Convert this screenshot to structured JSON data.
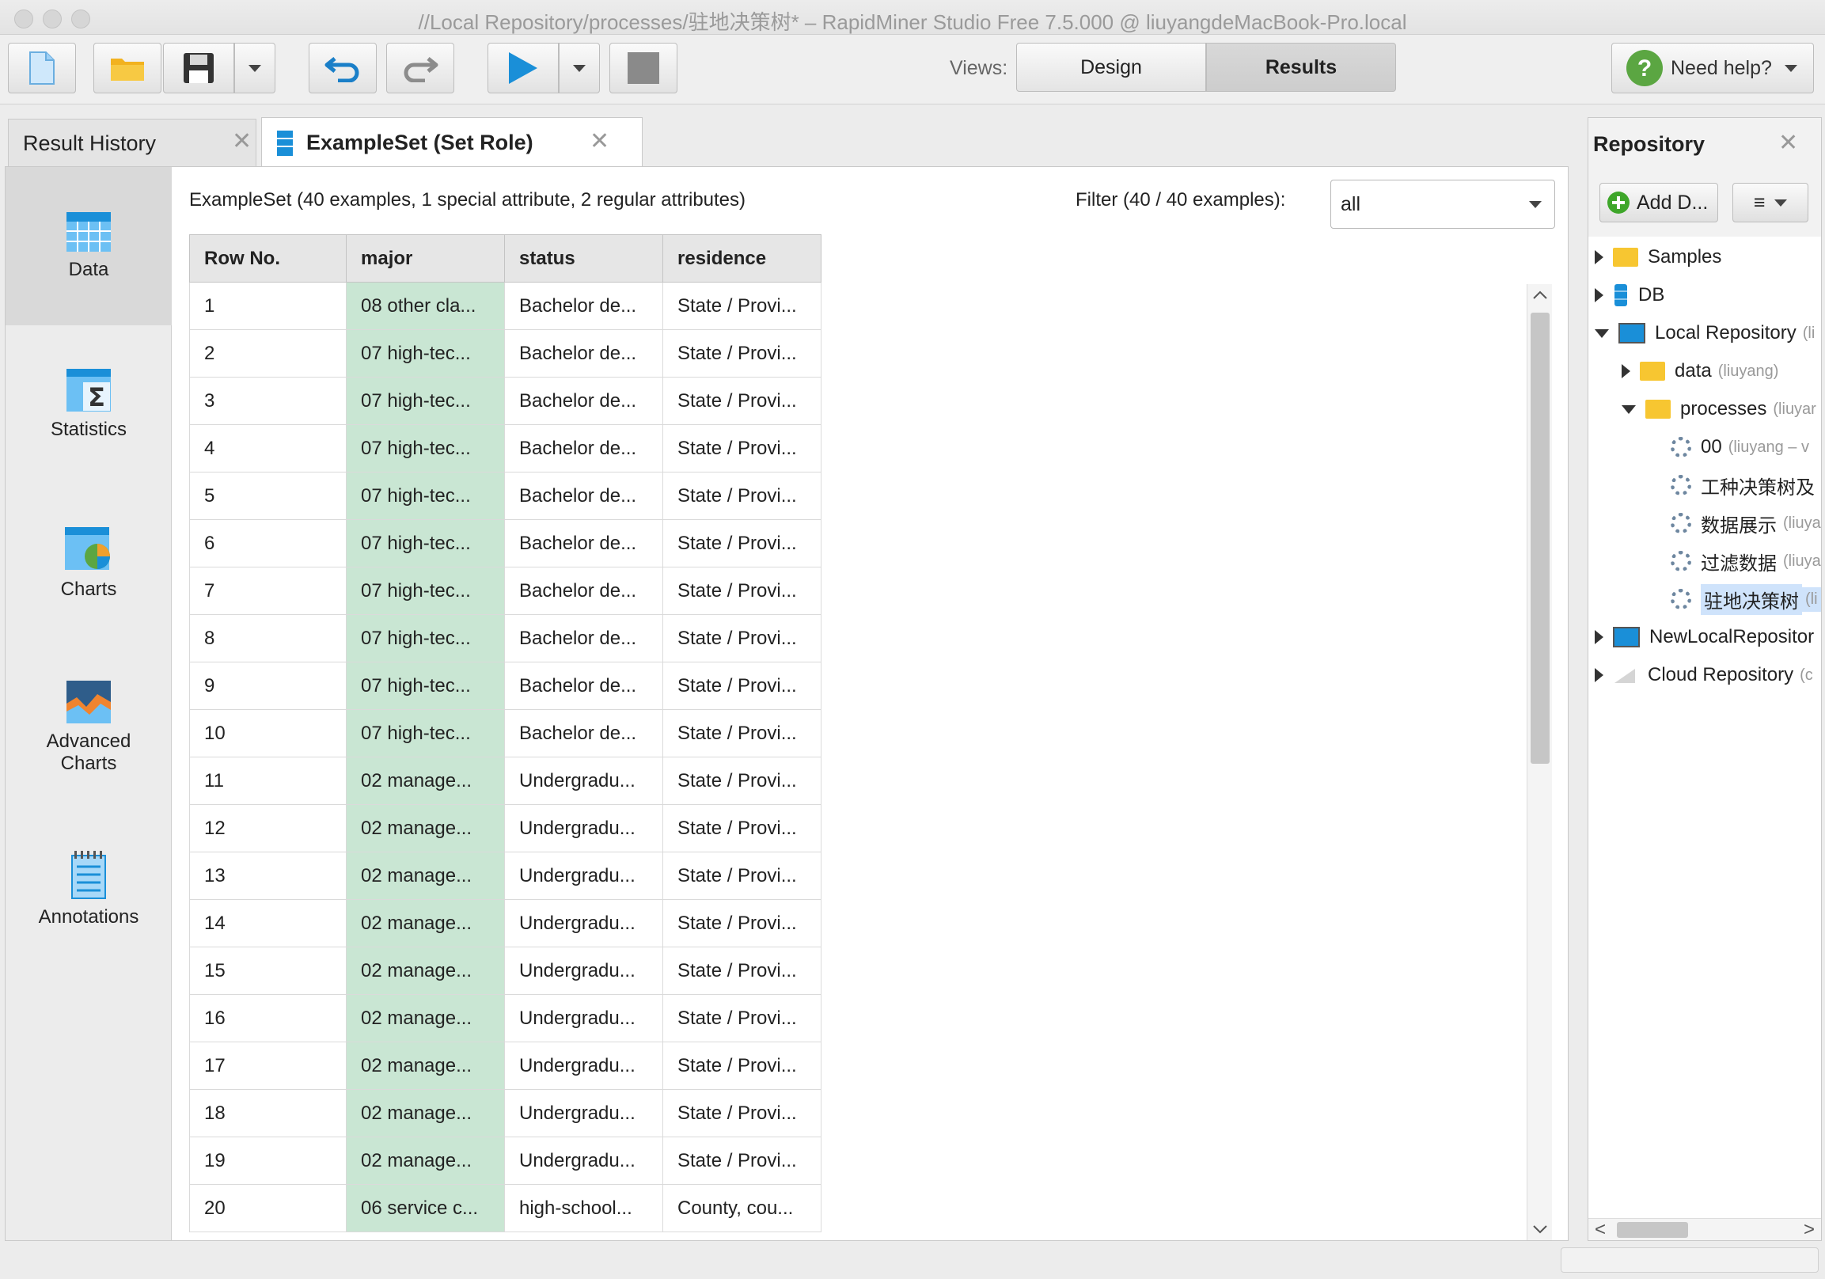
{
  "window": {
    "title": "//Local Repository/processes/驻地决策树* – RapidMiner Studio Free 7.5.000 @ liuyangdeMacBook-Pro.local"
  },
  "toolbar": {
    "views_label": "Views:",
    "design_label": "Design",
    "results_label": "Results",
    "help_label": "Need help?"
  },
  "tabs": {
    "result_history": "Result History",
    "exampleset": "ExampleSet (Set Role)"
  },
  "sidenav": [
    {
      "label": "Data"
    },
    {
      "label": "Statistics"
    },
    {
      "label": "Charts"
    },
    {
      "label": "Advanced Charts"
    },
    {
      "label": "Annotations"
    }
  ],
  "results": {
    "summary": "ExampleSet (40 examples, 1 special attribute, 2 regular attributes)",
    "filter_label": "Filter (40 / 40 examples):",
    "filter_value": "all",
    "columns": [
      "Row No.",
      "major",
      "status",
      "residence"
    ],
    "rows": [
      [
        "1",
        "08 other cla...",
        "Bachelor de...",
        "State / Provi..."
      ],
      [
        "2",
        "07 high-tec...",
        "Bachelor de...",
        "State / Provi..."
      ],
      [
        "3",
        "07 high-tec...",
        "Bachelor de...",
        "State / Provi..."
      ],
      [
        "4",
        "07 high-tec...",
        "Bachelor de...",
        "State / Provi..."
      ],
      [
        "5",
        "07 high-tec...",
        "Bachelor de...",
        "State / Provi..."
      ],
      [
        "6",
        "07 high-tec...",
        "Bachelor de...",
        "State / Provi..."
      ],
      [
        "7",
        "07 high-tec...",
        "Bachelor de...",
        "State / Provi..."
      ],
      [
        "8",
        "07 high-tec...",
        "Bachelor de...",
        "State / Provi..."
      ],
      [
        "9",
        "07 high-tec...",
        "Bachelor de...",
        "State / Provi..."
      ],
      [
        "10",
        "07 high-tec...",
        "Bachelor de...",
        "State / Provi..."
      ],
      [
        "11",
        "02 manage...",
        "Undergradu...",
        "State / Provi..."
      ],
      [
        "12",
        "02 manage...",
        "Undergradu...",
        "State / Provi..."
      ],
      [
        "13",
        "02 manage...",
        "Undergradu...",
        "State / Provi..."
      ],
      [
        "14",
        "02 manage...",
        "Undergradu...",
        "State / Provi..."
      ],
      [
        "15",
        "02 manage...",
        "Undergradu...",
        "State / Provi..."
      ],
      [
        "16",
        "02 manage...",
        "Undergradu...",
        "State / Provi..."
      ],
      [
        "17",
        "02 manage...",
        "Undergradu...",
        "State / Provi..."
      ],
      [
        "18",
        "02 manage...",
        "Undergradu...",
        "State / Provi..."
      ],
      [
        "19",
        "02 manage...",
        "Undergradu...",
        "State / Provi..."
      ],
      [
        "20",
        "06 service c...",
        "high-school...",
        "County, cou..."
      ]
    ]
  },
  "repository": {
    "title": "Repository",
    "add_label": "Add D...",
    "menu_label": "≡",
    "nodes": {
      "samples": "Samples",
      "db": "DB",
      "local": "Local Repository",
      "local_sub": "(li",
      "data": "data",
      "data_sub": "(liuyang)",
      "processes": "processes",
      "processes_sub": "(liuyar",
      "p00": "00",
      "p00_sub": "(liuyang – v",
      "p1": "工种决策树及",
      "p2": "数据展示",
      "p2_sub": "(liuya",
      "p3": "过滤数据",
      "p3_sub": "(liuya",
      "p4": "驻地决策树",
      "p4_sub": "(li",
      "newlocal": "NewLocalRepositor",
      "cloud": "Cloud Repository",
      "cloud_sub": "(c"
    }
  },
  "colors": {
    "major_column": "#c9e6d3",
    "selected_node": "#cfe3fb",
    "play_blue": "#1a8fd8"
  }
}
